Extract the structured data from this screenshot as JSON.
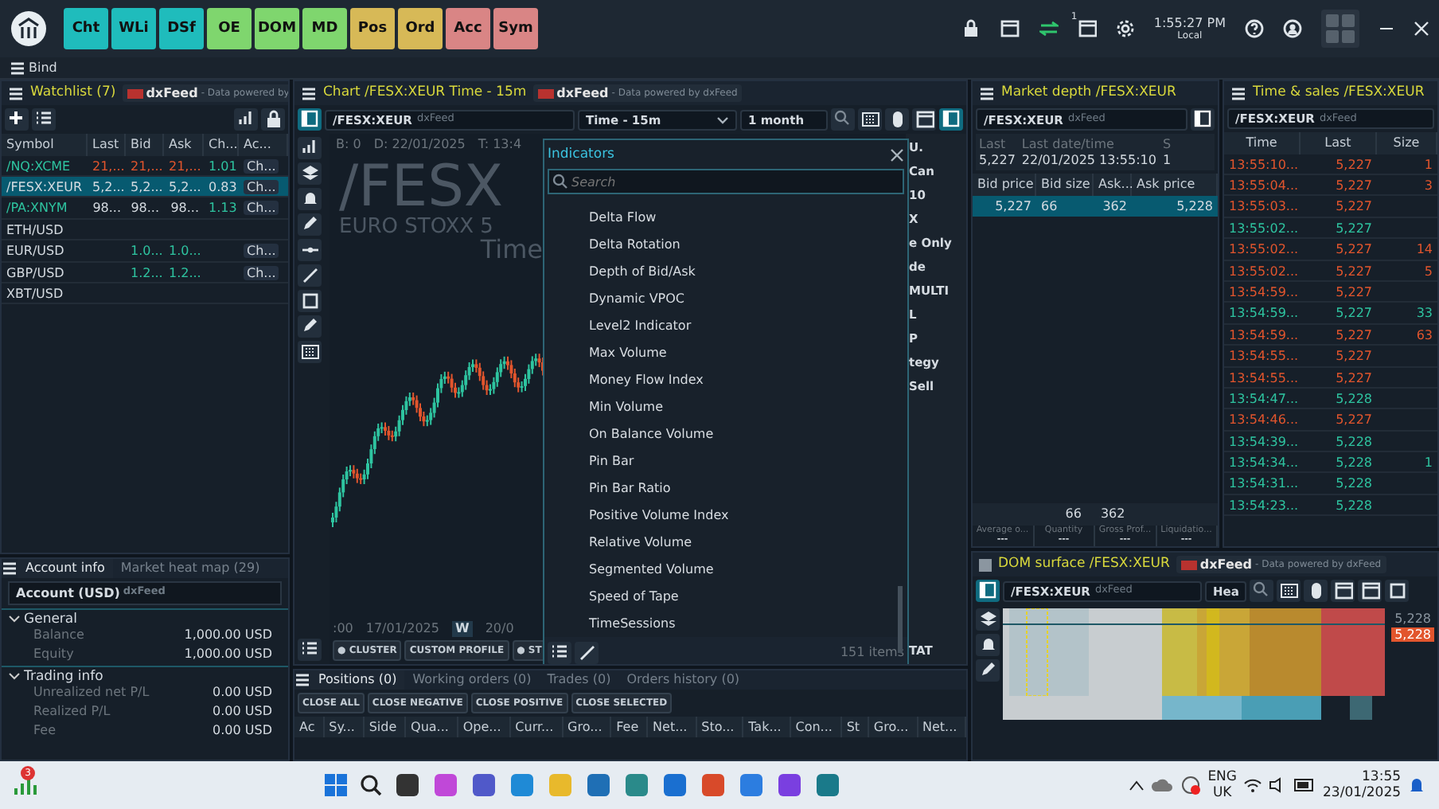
{
  "toolbar": {
    "buttons": [
      {
        "label": "Cht",
        "color": "#1fbcbc"
      },
      {
        "label": "WLi",
        "color": "#1fbcbc"
      },
      {
        "label": "DSf",
        "color": "#1fbcbc"
      },
      {
        "label": "OE",
        "color": "#7fd66e"
      },
      {
        "label": "DOM",
        "color": "#7fd66e"
      },
      {
        "label": "MD",
        "color": "#7fd66e"
      },
      {
        "label": "Pos",
        "color": "#d7b957"
      },
      {
        "label": "Ord",
        "color": "#d7b957"
      },
      {
        "label": "Acc",
        "color": "#d98585"
      },
      {
        "label": "Sym",
        "color": "#d98585"
      }
    ],
    "chat_badge": "1",
    "clock": {
      "time": "1:55:27 PM",
      "zone": "Local"
    }
  },
  "workspace": {
    "title": "Bind"
  },
  "watchlist": {
    "title": "Watchlist (7)",
    "feed": "dxFeed",
    "feed_note": "- Data powered by",
    "columns": [
      "Symbol",
      "Last",
      "Bid",
      "Ask",
      "Ch...",
      "Ac..."
    ],
    "rows": [
      {
        "selected": false,
        "symbol": {
          "text": "/NQ:XCME",
          "color": "#2ec4a0"
        },
        "last": {
          "text": "21,...",
          "color": "#e2552d"
        },
        "bid": {
          "text": "21,...",
          "color": "#e2552d"
        },
        "ask": {
          "text": "21,...",
          "color": "#e2552d"
        },
        "change": {
          "text": "1.01",
          "color": "#2ec4a0"
        },
        "action": {
          "text": "Ch..."
        }
      },
      {
        "selected": true,
        "symbol": {
          "text": "/FESX:XEUR"
        },
        "last": {
          "text": "5,2..."
        },
        "bid": {
          "text": "5,2..."
        },
        "ask": {
          "text": "5,2..."
        },
        "change": {
          "text": "0.83"
        },
        "action": {
          "text": "Ch..."
        }
      },
      {
        "selected": false,
        "symbol": {
          "text": "/PA:XNYM",
          "color": "#2ec4a0"
        },
        "last": {
          "text": "98..."
        },
        "bid": {
          "text": "98..."
        },
        "ask": {
          "text": "98..."
        },
        "change": {
          "text": "1.13",
          "color": "#2ec4a0"
        },
        "action": {
          "text": "Ch..."
        }
      },
      {
        "selected": false,
        "symbol": {
          "text": "ETH/USD"
        }
      },
      {
        "selected": false,
        "symbol": {
          "text": "EUR/USD"
        },
        "bid": {
          "text": "1.0...",
          "color": "#2ec4a0"
        },
        "ask": {
          "text": "1.0...",
          "color": "#2ec4a0"
        },
        "action": {
          "text": "Ch..."
        }
      },
      {
        "selected": false,
        "symbol": {
          "text": "GBP/USD"
        },
        "bid": {
          "text": "1.2...",
          "color": "#2ec4a0"
        },
        "ask": {
          "text": "1.2...",
          "color": "#2ec4a0"
        },
        "action": {
          "text": "Ch..."
        }
      },
      {
        "selected": false,
        "symbol": {
          "text": "XBT/USD"
        }
      }
    ]
  },
  "account": {
    "tabs": [
      {
        "label": "Account info",
        "selected": true
      },
      {
        "label": "Market heat map (29)",
        "selected": false
      }
    ],
    "account": "Account (USD)",
    "feed": "dxFeed",
    "groups": [
      {
        "title": "General",
        "expanded": true,
        "items": [
          {
            "label": "Balance",
            "value": "1,000.00 USD"
          },
          {
            "label": "Equity",
            "value": "1,000.00 USD"
          }
        ]
      },
      {
        "title": "Trading info",
        "expanded": true,
        "items": [
          {
            "label": "Unrealized net P/L",
            "value": "0.00 USD"
          },
          {
            "label": "Realized P/L",
            "value": "0.00 USD"
          },
          {
            "label": "Fee",
            "value": "0.00 USD"
          }
        ]
      }
    ]
  },
  "chart": {
    "title": "Chart /FESX:XEUR Time - 15m",
    "feed": "dxFeed",
    "feed_note": "- Data powered by dxFeed",
    "symbol": "/FESX:XEUR",
    "symbol_feed": "dxFeed",
    "timeframe": "Time - 15m",
    "range": "1 month",
    "info": [
      "B: 0",
      "D: 22/01/2025",
      "T: 13:4"
    ],
    "watermark": [
      "/FESX",
      "EURO STOXX 5",
      "Time"
    ],
    "axis_labels": [
      ":00",
      "17/01/2025",
      "W",
      "20/0"
    ],
    "bottom_buttons": [
      "● CLUSTER",
      "CUSTOM PROFILE",
      "● ST"
    ],
    "side_texts": [
      "U.",
      "Can",
      "10",
      "X",
      "e Only",
      "de",
      "MULTI",
      "L",
      "P",
      "tegy",
      "Sell",
      "TAT"
    ]
  },
  "indicators": {
    "title": "Indicators",
    "placeholder": "Search",
    "items": [
      "Delta Flow",
      "Delta Rotation",
      "Depth of Bid/Ask",
      "Dynamic VPOC",
      "Level2 Indicator",
      "Max Volume",
      "Money Flow Index",
      "Min Volume",
      "On Balance Volume",
      "Pin Bar",
      "Pin Bar Ratio",
      "Positive Volume Index",
      "Relative Volume",
      "Segmented Volume",
      "Speed of Tape",
      "TimeSessions"
    ],
    "count": "151 items"
  },
  "positions": {
    "tabs": [
      {
        "label": "Positions (0)",
        "selected": true
      },
      {
        "label": "Working orders (0)",
        "selected": false
      },
      {
        "label": "Trades (0)",
        "selected": false
      },
      {
        "label": "Orders history (0)",
        "selected": false
      }
    ],
    "buttons": [
      "CLOSE ALL",
      "CLOSE NEGATIVE",
      "CLOSE POSITIVE",
      "CLOSE SELECTED"
    ],
    "columns": [
      "Ac",
      "Sy...",
      "Side",
      "Qua...",
      "Ope...",
      "Curr...",
      "Gro...",
      "Fee",
      "Net...",
      "Sto...",
      "Tak...",
      "Con...",
      "St",
      "Gro...",
      "Net..."
    ]
  },
  "market_depth": {
    "title": "Market depth /FESX:XEUR",
    "symbol": "/FESX:XEUR",
    "symbol_feed": "dxFeed",
    "stats": [
      {
        "label": "Last",
        "value": "5,227"
      },
      {
        "label": "Last date/time",
        "value": "22/01/2025 13:55:10"
      },
      {
        "label": "S",
        "value": "1"
      }
    ],
    "columns": [
      "Bid price",
      "Bid size",
      "Ask...",
      "Ask price"
    ],
    "rows": [
      [
        "5,227",
        "66",
        "362",
        "5,228"
      ]
    ],
    "totals": [
      "66",
      "362"
    ],
    "footer": [
      {
        "label": "Average o...",
        "value": "---"
      },
      {
        "label": "Quantity",
        "value": "---"
      },
      {
        "label": "Gross Prof...",
        "value": "---"
      },
      {
        "label": "Liquidatio...",
        "value": "---"
      }
    ]
  },
  "time_sales": {
    "title": "Time & sales /FESX:XEUR",
    "symbol": "/FESX:XEUR",
    "symbol_feed": "dxFeed",
    "columns": [
      "Time",
      "Last",
      "Size"
    ],
    "rows": [
      {
        "time": "13:55:10...",
        "last": "5,227",
        "size": "1",
        "color": "#e2552d"
      },
      {
        "time": "13:55:04...",
        "last": "5,227",
        "size": "3",
        "color": "#e2552d"
      },
      {
        "time": "13:55:03...",
        "last": "5,227",
        "color": "#e2552d"
      },
      {
        "time": "13:55:02...",
        "last": "5,227",
        "color": "#2ec4a0"
      },
      {
        "time": "13:55:02...",
        "last": "5,227",
        "size": "14",
        "color": "#e2552d"
      },
      {
        "time": "13:55:02...",
        "last": "5,227",
        "size": "5",
        "color": "#e2552d"
      },
      {
        "time": "13:54:59...",
        "last": "5,227",
        "color": "#e2552d"
      },
      {
        "time": "13:54:59...",
        "last": "5,227",
        "size": "33",
        "color": "#2ec4a0"
      },
      {
        "time": "13:54:59...",
        "last": "5,227",
        "size": "63",
        "color": "#e2552d"
      },
      {
        "time": "13:54:55...",
        "last": "5,227",
        "color": "#e2552d"
      },
      {
        "time": "13:54:55...",
        "last": "5,227",
        "color": "#e2552d"
      },
      {
        "time": "13:54:47...",
        "last": "5,228",
        "color": "#2ec4a0"
      },
      {
        "time": "13:54:46...",
        "last": "5,227",
        "color": "#e2552d"
      },
      {
        "time": "13:54:39...",
        "last": "5,228",
        "color": "#2ec4a0"
      },
      {
        "time": "13:54:34...",
        "last": "5,228",
        "size": "1",
        "color": "#2ec4a0"
      },
      {
        "time": "13:54:31...",
        "last": "5,228",
        "color": "#2ec4a0"
      },
      {
        "time": "13:54:23...",
        "last": "5,228",
        "color": "#2ec4a0"
      }
    ]
  },
  "dom_surface": {
    "title": "DOM surface /FESX:XEUR",
    "feed": "dxFeed",
    "feed_note": "- Data powered by dxFeed",
    "symbol": "/FESX:XEUR",
    "symbol_feed": "dxFeed",
    "mode": "Hea",
    "prices": [
      "5,228",
      "5,228"
    ]
  },
  "taskbar": {
    "badge": "3",
    "language": "ENG",
    "region": "UK",
    "time": "13:55",
    "date": "23/01/2025"
  }
}
